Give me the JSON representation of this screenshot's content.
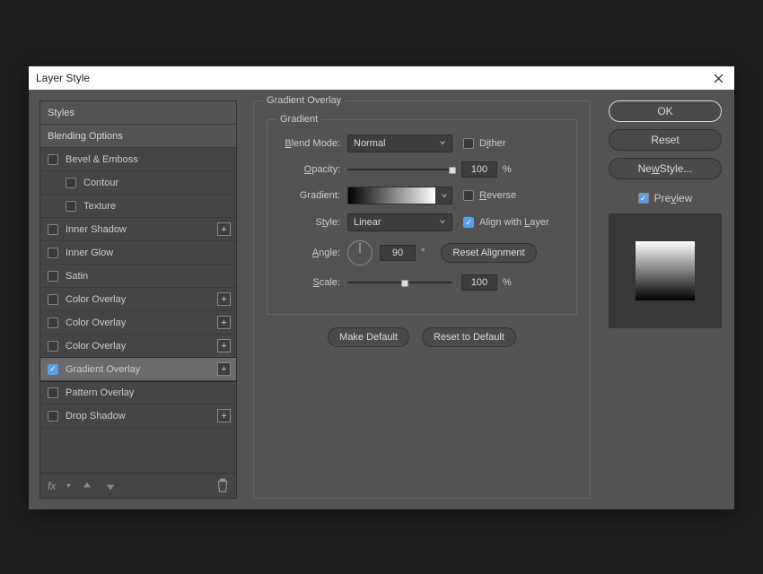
{
  "dialog": {
    "title": "Layer Style"
  },
  "left": {
    "styles_header": "Styles",
    "blending_options": "Blending Options",
    "items": [
      {
        "label": "Bevel & Emboss",
        "checked": false,
        "plus": false
      },
      {
        "label": "Contour",
        "checked": false,
        "plus": false,
        "sub": true
      },
      {
        "label": "Texture",
        "checked": false,
        "plus": false,
        "sub": true
      },
      {
        "label": "Inner Shadow",
        "checked": false,
        "plus": true
      },
      {
        "label": "Inner Glow",
        "checked": false,
        "plus": false
      },
      {
        "label": "Satin",
        "checked": false,
        "plus": false
      },
      {
        "label": "Color Overlay",
        "checked": false,
        "plus": true
      },
      {
        "label": "Color Overlay",
        "checked": false,
        "plus": true
      },
      {
        "label": "Color Overlay",
        "checked": false,
        "plus": true
      },
      {
        "label": "Gradient Overlay",
        "checked": true,
        "plus": true,
        "active": true
      },
      {
        "label": "Pattern Overlay",
        "checked": false,
        "plus": false
      },
      {
        "label": "Drop Shadow",
        "checked": false,
        "plus": true
      }
    ],
    "footer_fx": "fx"
  },
  "center": {
    "group_title": "Gradient Overlay",
    "inner_title": "Gradient",
    "blend_mode_label": "Blend Mode:",
    "blend_mode_value": "Normal",
    "dither_label": "Dither",
    "dither_checked": false,
    "opacity_label": "Opacity:",
    "opacity_value": "100",
    "opacity_unit": "%",
    "gradient_label": "Gradient:",
    "reverse_label": "Reverse",
    "reverse_checked": false,
    "style_label": "Style:",
    "style_value": "Linear",
    "align_label": "Align with Layer",
    "align_checked": true,
    "angle_label": "Angle:",
    "angle_value": "90",
    "angle_unit": "°",
    "reset_alignment": "Reset Alignment",
    "scale_label": "Scale:",
    "scale_value": "100",
    "scale_unit": "%",
    "make_default": "Make Default",
    "reset_default": "Reset to Default"
  },
  "right": {
    "ok": "OK",
    "reset": "Reset",
    "new_style": "New Style...",
    "preview_label": "Preview",
    "preview_checked": true
  }
}
